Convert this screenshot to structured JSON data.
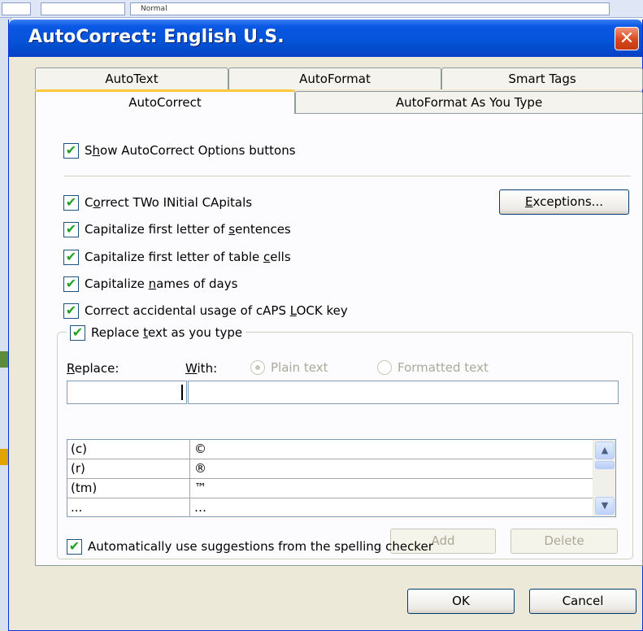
{
  "window": {
    "title": "AutoCorrect: English U.S.",
    "close_glyph": "✕",
    "background_app_field": "Normal"
  },
  "tabs_back": [
    {
      "label": "AutoText"
    },
    {
      "label": "AutoFormat"
    },
    {
      "label": "Smart Tags"
    }
  ],
  "tabs_front": [
    {
      "label": "AutoCorrect",
      "active": true
    },
    {
      "label": "AutoFormat As You Type",
      "active": false
    }
  ],
  "options": {
    "show_buttons": {
      "pre": "S",
      "key": "h",
      "post": "ow AutoCorrect Options buttons",
      "checked": true
    },
    "two_initials": {
      "pre": "C",
      "key": "o",
      "post": "rrect TWo INitial CApitals",
      "checked": true
    },
    "first_letter_sentences": {
      "pre": "Capitalize first letter of ",
      "key": "s",
      "post": "entences",
      "checked": true
    },
    "first_letter_cells": {
      "pre": "Capitalize first letter of table ",
      "key": "c",
      "post": "ells",
      "checked": true
    },
    "names_of_days": {
      "pre": "Capitalize ",
      "key": "n",
      "post": "ames of days",
      "checked": true
    },
    "caps_lock": {
      "pre": "Correct accidental usage of cAPS ",
      "key": "L",
      "post": "OCK key",
      "checked": true
    },
    "replace_text": {
      "pre": "Replace ",
      "key": "t",
      "post": "ext as you type",
      "checked": true
    },
    "spelling_suggestions": {
      "pre": "Automatically use sug",
      "key": "g",
      "post": "estions from the spelling checker",
      "checked": true
    }
  },
  "exceptions_button": {
    "key": "E",
    "rest": "xceptions..."
  },
  "replace_section": {
    "replace_label": {
      "key": "R",
      "rest": "eplace:"
    },
    "with_label": {
      "key": "W",
      "rest": "ith:"
    },
    "plain_text": "Plain text",
    "formatted_text": "Formatted text",
    "replace_value": "",
    "with_value": ""
  },
  "table_rows": [
    {
      "replace": "(c)",
      "with": "©"
    },
    {
      "replace": "(r)",
      "with": "®"
    },
    {
      "replace": "(tm)",
      "with": "™"
    },
    {
      "replace": "...",
      "with": "…"
    }
  ],
  "buttons": {
    "add": "Add",
    "delete": "Delete",
    "ok": "OK",
    "cancel": "Cancel"
  },
  "colors": {
    "title_bar": "#0453d6",
    "dialog_bg": "#ece9d8",
    "active_tab_accent": "#ffc83c",
    "checkmark": "#21a121",
    "close_button": "#d9471c"
  }
}
